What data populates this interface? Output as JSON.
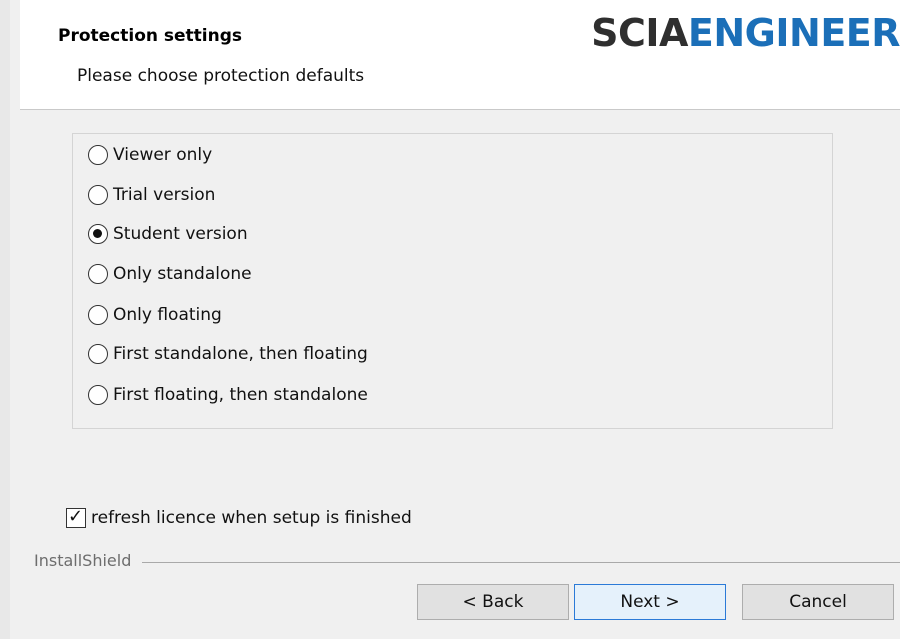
{
  "header": {
    "title": "Protection settings",
    "subtitle": "Please choose protection defaults",
    "logo_part1": "SCIA",
    "logo_part2": "ENGINEER"
  },
  "options": [
    {
      "label": "Viewer only",
      "selected": false
    },
    {
      "label": "Trial version",
      "selected": false
    },
    {
      "label": "Student version",
      "selected": true
    },
    {
      "label": "Only standalone",
      "selected": false
    },
    {
      "label": "Only floating",
      "selected": false
    },
    {
      "label": "First standalone, then floating",
      "selected": false
    },
    {
      "label": "First floating, then standalone",
      "selected": false
    }
  ],
  "refresh": {
    "label": "refresh licence when setup is finished",
    "checked": true
  },
  "footer": {
    "installshield": "InstallShield"
  },
  "buttons": {
    "back": "< Back",
    "next": "Next >",
    "cancel": "Cancel"
  },
  "colors": {
    "logo_dark": "#2f2f2f",
    "logo_blue": "#1b6fb8",
    "default_button_border": "#2b7ad7"
  }
}
